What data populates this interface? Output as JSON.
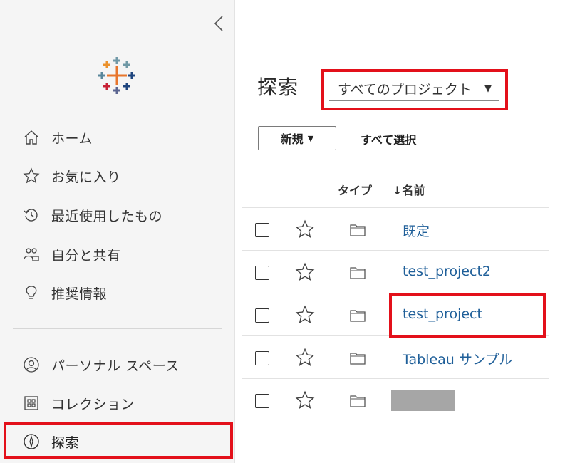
{
  "sidebar": {
    "items": [
      {
        "label": "ホーム",
        "icon": "home-icon"
      },
      {
        "label": "お気に入り",
        "icon": "star-icon"
      },
      {
        "label": "最近使用したもの",
        "icon": "recent-icon"
      },
      {
        "label": "自分と共有",
        "icon": "shared-users-icon"
      },
      {
        "label": "推奨情報",
        "icon": "lightbulb-icon"
      },
      {
        "label": "パーソナル スペース",
        "icon": "user-circle-icon"
      },
      {
        "label": "コレクション",
        "icon": "collection-icon"
      },
      {
        "label": "探索",
        "icon": "compass-icon"
      }
    ],
    "active_item": "探索"
  },
  "main": {
    "title": "探索",
    "project_filter": {
      "selected": "すべてのプロジェクト"
    },
    "toolbar": {
      "new_label": "新規",
      "select_all_label": "すべて選択"
    },
    "columns": {
      "type": "タイプ",
      "name": "↓名前"
    },
    "rows": [
      {
        "name": "既定",
        "type": "folder-icon"
      },
      {
        "name": "test_project2",
        "type": "folder-icon"
      },
      {
        "name": "test_project",
        "type": "folder-icon"
      },
      {
        "name": "Tableau サンプル",
        "type": "folder-icon"
      },
      {
        "name": "",
        "type": "folder-icon",
        "redacted": true
      }
    ]
  },
  "colors": {
    "highlight": "#e3101a",
    "link": "#1f5f99",
    "sidebar_bg": "#f5f5f5"
  }
}
